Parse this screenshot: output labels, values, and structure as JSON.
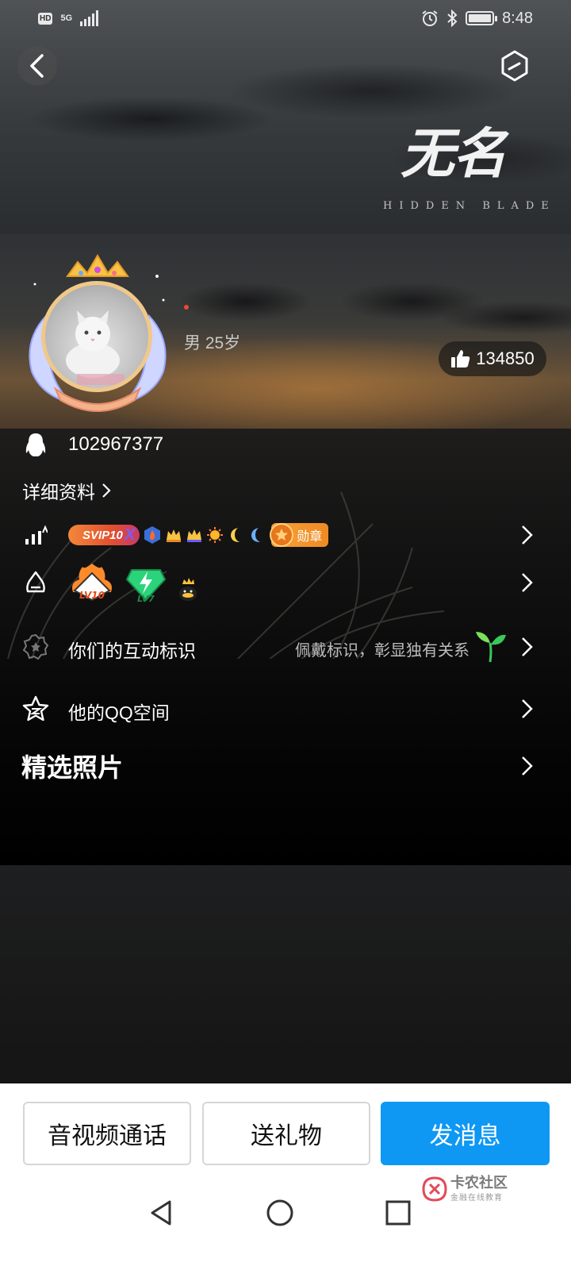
{
  "status_bar": {
    "network_hd": "HD",
    "network_gen": "5G",
    "time": "8:48"
  },
  "cover": {
    "logo_title": "无名",
    "logo_subtitle": "HIDDEN BLADE"
  },
  "profile": {
    "gender_age": "男 25岁",
    "likes": "134850",
    "qq_number": "102967377",
    "detail_link": "详细资料"
  },
  "badges": {
    "svip_label": "SVIP10",
    "svip_suffix": "X",
    "medal_label": "勋章",
    "lv_badges": [
      "LV10",
      "LV7"
    ]
  },
  "rows": {
    "interaction_label": "你们的互动标识",
    "interaction_hint": "佩戴标识，彰显独有关系",
    "qzone_label": "他的QQ空间",
    "photos_title": "精选照片"
  },
  "actions": {
    "call": "音视频通话",
    "gift": "送礼物",
    "message": "发消息"
  },
  "watermark": {
    "title": "卡农社区",
    "subtitle": "金融在线教育"
  },
  "colors": {
    "primary": "#0e98f4",
    "medal": "#f6a23a",
    "svip": "#e2502f"
  },
  "icons": [
    "back-icon",
    "card-switch-icon",
    "like-icon",
    "qq-penguin-icon",
    "level-icon",
    "bell-icon",
    "gear-badge-icon",
    "star-icon",
    "chevron-right-icon",
    "sprout-icon"
  ]
}
